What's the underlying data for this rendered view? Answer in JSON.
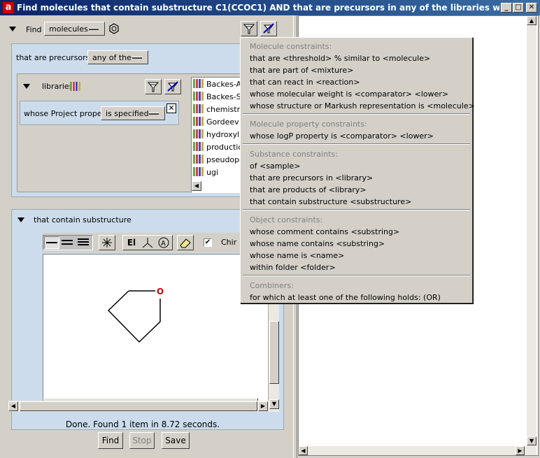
{
  "window": {
    "title": "Find molecules that contain substructure C1(CCOC1) AND that are precursors in any of the libraries whose Project proper...",
    "app_icon": "a"
  },
  "find": {
    "label": "Find",
    "selected": "molecules"
  },
  "precursors": {
    "label": "that are precursors in",
    "selected": "any of the"
  },
  "libraries": {
    "label": "libraries",
    "constraint_label": "whose Project property",
    "constraint_selected": "is specified",
    "items": [
      "Backes-A",
      "Backes-S",
      "chemistry",
      "Gordeev",
      "hydroxyla",
      "production",
      "pseudope",
      "ugi"
    ]
  },
  "substructure": {
    "label": "that contain substructure",
    "chiral_label": "Chir",
    "element_button": "El",
    "atom_label": "O"
  },
  "status": {
    "text": "Done. Found 1 item in 8.72 seconds."
  },
  "buttons": {
    "find": "Find",
    "stop": "Stop",
    "save": "Save"
  },
  "menu": {
    "molecule_header": "Molecule constraints:",
    "molecule_items": [
      "that are <threshold> % similar to <molecule>",
      "that are part of <mixture>",
      "that can react in <reaction>",
      "whose molecular weight is <comparator>  <lower>",
      "whose structure or Markush representation is <molecule>"
    ],
    "property_header": "Molecule property constraints:",
    "property_items": [
      "whose logP property is <comparator>  <lower>"
    ],
    "substance_header": "Substance constraints:",
    "substance_items": [
      "of <sample>",
      "that are precursors in <library>",
      "that are products of <library>",
      "that contain substructure <substructure>"
    ],
    "object_header": "Object constraints:",
    "object_items": [
      "whose comment contains <substring>",
      "whose name contains <substring>",
      "whose name is <name>",
      "within folder <folder>"
    ],
    "combiner_header": "Combiners:",
    "combiner_items": [
      "for which at least one of the following holds: (OR)"
    ]
  },
  "colors": {
    "title_start": "#0a246a",
    "title_end": "#3a6ea5",
    "panel_blue": "#ccdcec",
    "atom_oxygen": "#cc0000"
  }
}
